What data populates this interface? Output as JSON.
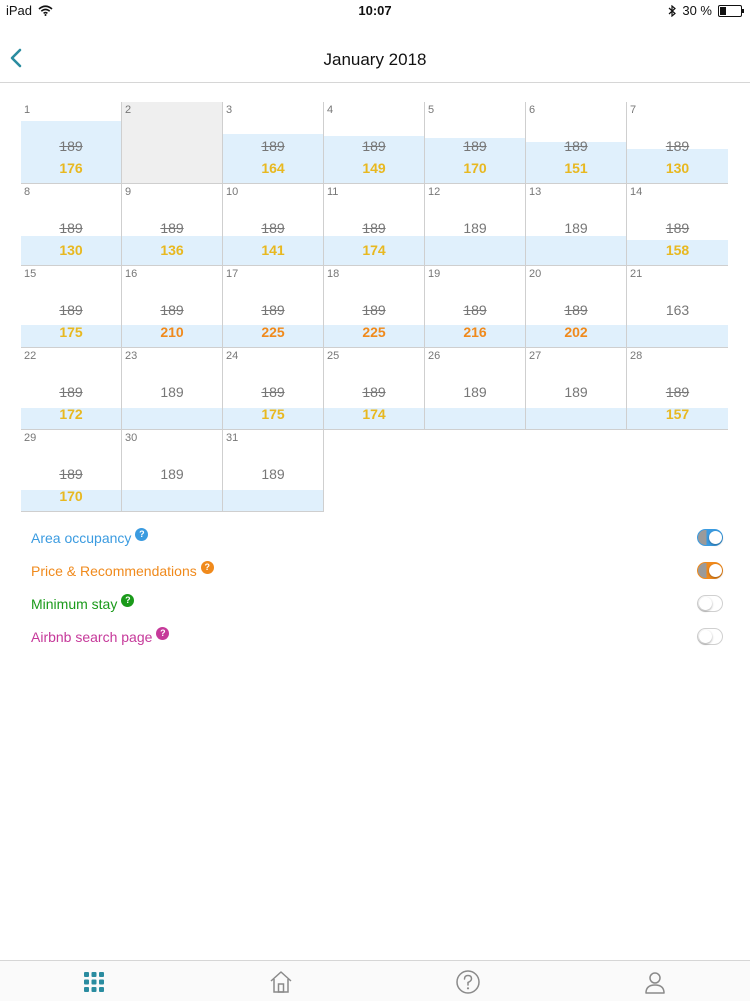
{
  "status_bar": {
    "carrier": "iPad",
    "time": "10:07",
    "battery": "30 %",
    "battery_level": 0.3
  },
  "header": {
    "title": "January 2018"
  },
  "colors": {
    "occupancy_band": "#e0f0fc",
    "price_yellow": "#e8b820",
    "price_orange": "#f08a1c",
    "accent_teal": "#2a8ca0",
    "area_blue": "#3b9be0",
    "min_stay_green": "#1a9a1a",
    "airbnb_magenta": "#c6399a"
  },
  "calendar": {
    "rows": [
      [
        {
          "day": "1",
          "old": "189",
          "new": "176",
          "tone": "yellow",
          "occupancy": 0.75
        },
        {
          "day": "2",
          "disabled": true
        },
        {
          "day": "3",
          "old": "189",
          "new": "164",
          "tone": "yellow",
          "occupancy": 0.6
        },
        {
          "day": "4",
          "old": "189",
          "new": "149",
          "tone": "yellow",
          "occupancy": 0.57
        },
        {
          "day": "5",
          "old": "189",
          "new": "170",
          "tone": "yellow",
          "occupancy": 0.55
        },
        {
          "day": "6",
          "old": "189",
          "new": "151",
          "tone": "yellow",
          "occupancy": 0.5
        },
        {
          "day": "7",
          "old": "189",
          "new": "130",
          "tone": "yellow",
          "occupancy": 0.41
        }
      ],
      [
        {
          "day": "8",
          "old": "189",
          "new": "130",
          "tone": "yellow",
          "occupancy": 0.35
        },
        {
          "day": "9",
          "old": "189",
          "new": "136",
          "tone": "yellow",
          "occupancy": 0.35
        },
        {
          "day": "10",
          "old": "189",
          "new": "141",
          "tone": "yellow",
          "occupancy": 0.35
        },
        {
          "day": "11",
          "old": "189",
          "new": "174",
          "tone": "yellow",
          "occupancy": 0.35
        },
        {
          "day": "12",
          "plain": "189",
          "occupancy": 0.35
        },
        {
          "day": "13",
          "plain": "189",
          "occupancy": 0.35
        },
        {
          "day": "14",
          "old": "189",
          "new": "158",
          "tone": "yellow",
          "occupancy": 0.3
        }
      ],
      [
        {
          "day": "15",
          "old": "189",
          "new": "175",
          "tone": "yellow",
          "occupancy": 0.27
        },
        {
          "day": "16",
          "old": "189",
          "new": "210",
          "tone": "orange",
          "occupancy": 0.27
        },
        {
          "day": "17",
          "old": "189",
          "new": "225",
          "tone": "orange",
          "occupancy": 0.27
        },
        {
          "day": "18",
          "old": "189",
          "new": "225",
          "tone": "orange",
          "occupancy": 0.27
        },
        {
          "day": "19",
          "old": "189",
          "new": "216",
          "tone": "orange",
          "occupancy": 0.27
        },
        {
          "day": "20",
          "old": "189",
          "new": "202",
          "tone": "orange",
          "occupancy": 0.27
        },
        {
          "day": "21",
          "plain": "163",
          "occupancy": 0.27
        }
      ],
      [
        {
          "day": "22",
          "old": "189",
          "new": "172",
          "tone": "yellow",
          "occupancy": 0.25
        },
        {
          "day": "23",
          "plain": "189",
          "occupancy": 0.25
        },
        {
          "day": "24",
          "old": "189",
          "new": "175",
          "tone": "yellow",
          "occupancy": 0.25
        },
        {
          "day": "25",
          "old": "189",
          "new": "174",
          "tone": "yellow",
          "occupancy": 0.25
        },
        {
          "day": "26",
          "plain": "189",
          "occupancy": 0.25
        },
        {
          "day": "27",
          "plain": "189",
          "occupancy": 0.25
        },
        {
          "day": "28",
          "old": "189",
          "new": "157",
          "tone": "yellow",
          "occupancy": 0.25
        }
      ],
      [
        {
          "day": "29",
          "old": "189",
          "new": "170",
          "tone": "yellow",
          "occupancy": 0.25
        },
        {
          "day": "30",
          "plain": "189",
          "occupancy": 0.25
        },
        {
          "day": "31",
          "plain": "189",
          "occupancy": 0.25
        }
      ]
    ]
  },
  "legend": [
    {
      "label": "Area occupancy",
      "color": "#3b9be0",
      "help": "?",
      "on": true
    },
    {
      "label": "Price & Recommendations",
      "color": "#f08a1c",
      "help": "?",
      "on": true
    },
    {
      "label": "Minimum stay",
      "color": "#1a9a1a",
      "help": "?",
      "on": false
    },
    {
      "label": "Airbnb search page",
      "color": "#c6399a",
      "help": "?",
      "on": false
    }
  ],
  "tab_bar": {
    "tabs": [
      {
        "icon": "grid-icon",
        "active": true
      },
      {
        "icon": "home-icon",
        "active": false
      },
      {
        "icon": "help-icon",
        "active": false
      },
      {
        "icon": "profile-icon",
        "active": false
      }
    ]
  }
}
